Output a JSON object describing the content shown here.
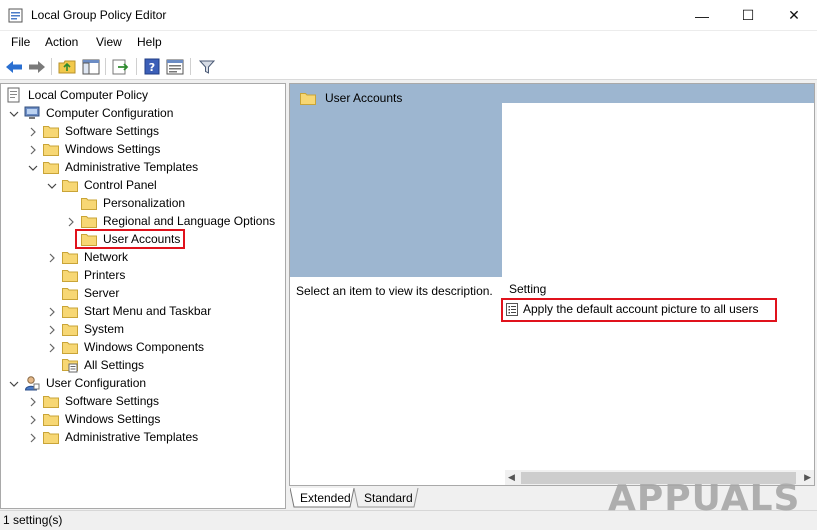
{
  "window": {
    "title": "Local Group Policy Editor",
    "controls": {
      "minimize": "—",
      "maximize": "☐",
      "close": "✕"
    }
  },
  "menu": [
    "File",
    "Action",
    "View",
    "Help"
  ],
  "toolbar": {
    "icons": [
      "back-arrow-icon",
      "forward-arrow-icon",
      "up-folder-icon",
      "show-hide-tree-icon",
      "export-list-icon",
      "help-icon",
      "properties-icon",
      "filter-icon"
    ]
  },
  "tree": {
    "root": "Local Computer Policy",
    "computer_configuration": "Computer Configuration",
    "cc_software_settings": "Software Settings",
    "cc_windows_settings": "Windows Settings",
    "cc_admin_templates": "Administrative Templates",
    "control_panel": "Control Panel",
    "personalization": "Personalization",
    "regional_language": "Regional and Language Options",
    "user_accounts": "User Accounts",
    "network": "Network",
    "printers": "Printers",
    "server": "Server",
    "start_menu": "Start Menu and Taskbar",
    "system": "System",
    "windows_components": "Windows Components",
    "all_settings": "All Settings",
    "user_configuration": "User Configuration",
    "uc_software_settings": "Software Settings",
    "uc_windows_settings": "Windows Settings",
    "uc_admin_templates": "Administrative Templates"
  },
  "details": {
    "header": "User Accounts",
    "description_prompt": "Select an item to view its description.",
    "column_setting": "Setting",
    "settings": [
      "Apply the default account picture to all users"
    ]
  },
  "tabs": [
    "Extended",
    "Standard"
  ],
  "status": "1 setting(s)",
  "watermark": "APPUALS",
  "colors": {
    "highlight": "#e0121c",
    "header_band": "#9db6d0",
    "folder": "#f7d774"
  }
}
